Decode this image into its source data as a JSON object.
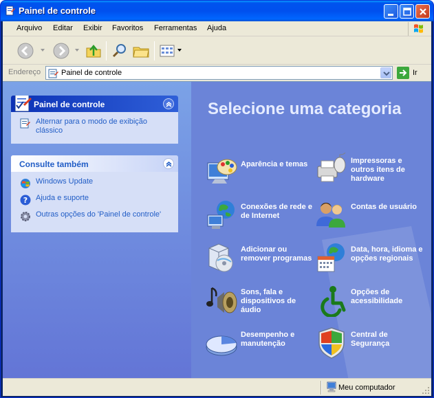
{
  "window": {
    "title": "Painel de controle"
  },
  "menu": {
    "items": [
      {
        "label": "Arquivo"
      },
      {
        "label": "Editar"
      },
      {
        "label": "Exibir"
      },
      {
        "label": "Favoritos"
      },
      {
        "label": "Ferramentas"
      },
      {
        "label": "Ajuda"
      }
    ]
  },
  "toolbar": {
    "icons": [
      "back-icon",
      "forward-icon",
      "up-folder-icon",
      "search-icon",
      "folders-icon",
      "views-icon"
    ]
  },
  "address": {
    "label": "Endereço",
    "value": "Painel de controle",
    "go_label": "Ir"
  },
  "sidebar": {
    "control_panel": {
      "title": "Painel de controle",
      "links": [
        {
          "label": "Alternar para o modo de exibição clássico",
          "icon": "classic-view-icon"
        }
      ]
    },
    "see_also": {
      "title": "Consulte também",
      "links": [
        {
          "label": "Windows Update",
          "icon": "windows-update-icon"
        },
        {
          "label": "Ajuda e suporte",
          "icon": "help-icon"
        },
        {
          "label": "Outras opções do 'Painel de controle'",
          "icon": "gear-icon"
        }
      ]
    }
  },
  "main": {
    "heading": "Selecione uma categoria",
    "categories": [
      {
        "label": "Aparência e temas",
        "icon": "appearance-icon"
      },
      {
        "label": "Impressoras e outros itens de hardware",
        "icon": "printer-icon"
      },
      {
        "label": "Conexões de rede e de Internet",
        "icon": "network-icon"
      },
      {
        "label": "Contas de usuário",
        "icon": "users-icon"
      },
      {
        "label": "Adicionar ou remover programas",
        "icon": "add-remove-icon"
      },
      {
        "label": "Data, hora, idioma e opções regionais",
        "icon": "date-time-icon"
      },
      {
        "label": "Sons, fala e dispositivos de áudio",
        "icon": "sound-icon"
      },
      {
        "label": "Opções de acessibilidade",
        "icon": "accessibility-icon"
      },
      {
        "label": "Desempenho e manutenção",
        "icon": "performance-icon"
      },
      {
        "label": "Central de Segurança",
        "icon": "security-center-icon"
      }
    ]
  },
  "status": {
    "text": "Meu computador"
  },
  "colors": {
    "title_bar": "#0054e3",
    "left_pane": "#7ba2e7",
    "main_pane": "#6b84d8",
    "link": "#215dc6"
  }
}
